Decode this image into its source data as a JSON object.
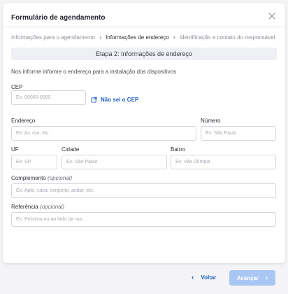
{
  "modal": {
    "title": "Formulário de agendamento"
  },
  "breadcrumb": {
    "step1": "Informações para o agendamento",
    "step2": "Informações de endereço",
    "step3": "Identificação e contato do responsável"
  },
  "step_banner": "Etapa 2: Informações de endereço",
  "intro": "Nos informe informe o endereço para a instalação dos dispositivos",
  "fields": {
    "cep": {
      "label": "CEP",
      "placeholder": "Ex: 00000-0000",
      "value": ""
    },
    "cep_link": "Não sei o CEP",
    "endereco": {
      "label": "Endereço",
      "placeholder": "Ex: Av, rua, etc.",
      "value": ""
    },
    "numero": {
      "label": "Número",
      "placeholder": "Ex: São Paulo",
      "value": ""
    },
    "uf": {
      "label": "UF",
      "placeholder": "Ex: SP",
      "value": ""
    },
    "cidade": {
      "label": "Cidade",
      "placeholder": "Ex: São Paulo",
      "value": ""
    },
    "bairro": {
      "label": "Bairro",
      "placeholder": "Ex: Vila Olímpia",
      "value": ""
    },
    "complemento": {
      "label": "Complemento",
      "optional": "(opcional)",
      "placeholder": "Ex: Apto, casa, conjunto, andar, etc.",
      "value": ""
    },
    "referencia": {
      "label": "Referência",
      "optional": "(opcional)",
      "placeholder": "Ex: Próxima ou ao lado da rua...",
      "value": ""
    }
  },
  "footer": {
    "back_label": "Voltar",
    "next_label": "Avançar"
  },
  "colors": {
    "link": "#1f5fbf",
    "next_button_disabled": "#a9c7f2"
  },
  "icons": {
    "close": "close-icon",
    "external": "external-link-icon",
    "back_chevron": "chevron-left-icon",
    "next_chevron": "chevron-right-icon"
  }
}
